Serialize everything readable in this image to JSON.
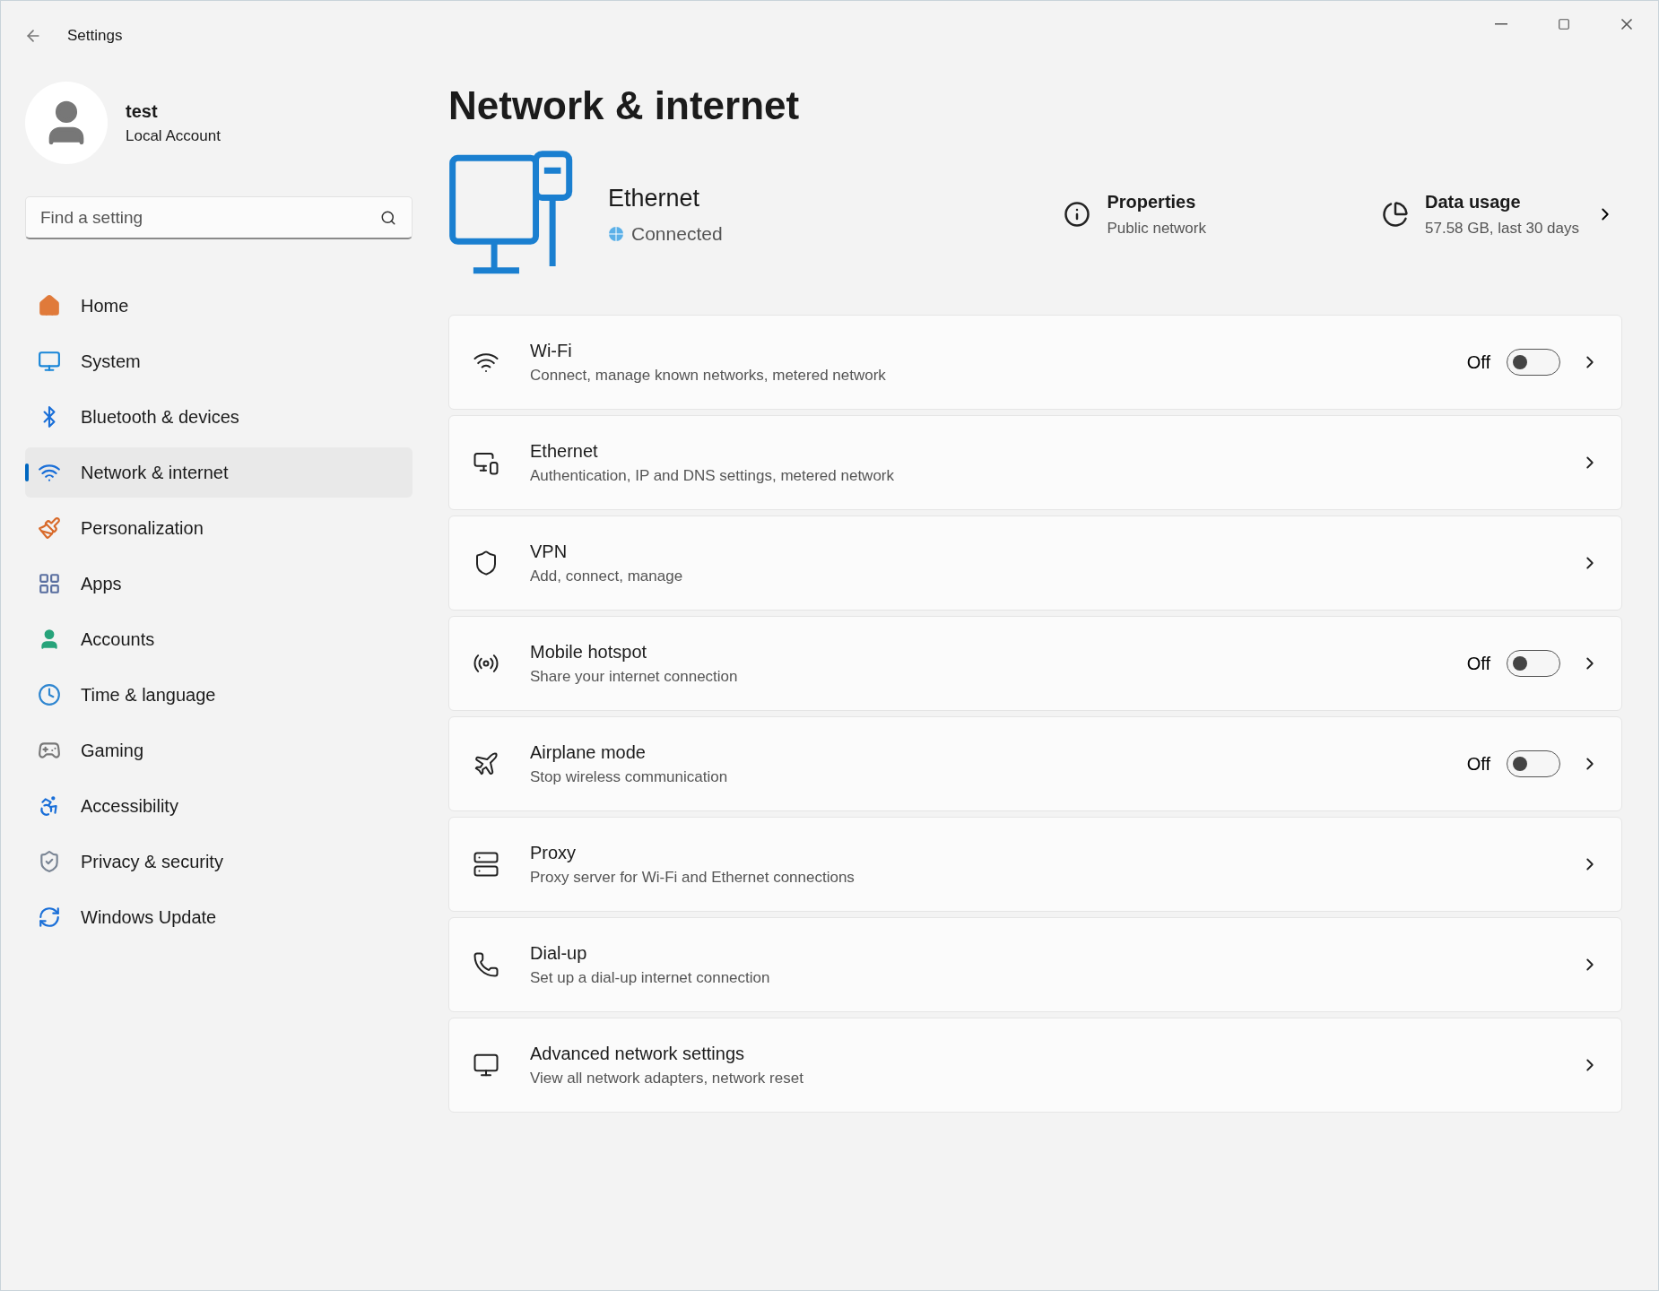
{
  "window": {
    "title": "Settings"
  },
  "user": {
    "name": "test",
    "account_type": "Local Account"
  },
  "search": {
    "placeholder": "Find a setting"
  },
  "sidebar": {
    "items": [
      {
        "label": "Home",
        "selected": false
      },
      {
        "label": "System",
        "selected": false
      },
      {
        "label": "Bluetooth & devices",
        "selected": false
      },
      {
        "label": "Network & internet",
        "selected": true
      },
      {
        "label": "Personalization",
        "selected": false
      },
      {
        "label": "Apps",
        "selected": false
      },
      {
        "label": "Accounts",
        "selected": false
      },
      {
        "label": "Time & language",
        "selected": false
      },
      {
        "label": "Gaming",
        "selected": false
      },
      {
        "label": "Accessibility",
        "selected": false
      },
      {
        "label": "Privacy & security",
        "selected": false
      },
      {
        "label": "Windows Update",
        "selected": false
      }
    ]
  },
  "page": {
    "title": "Network & internet",
    "connection": {
      "name": "Ethernet",
      "status": "Connected"
    },
    "properties": {
      "title": "Properties",
      "subtitle": "Public network"
    },
    "data_usage": {
      "title": "Data usage",
      "subtitle": "57.58 GB, last 30 days"
    },
    "cards": [
      {
        "kind": "toggle",
        "title": "Wi-Fi",
        "subtitle": "Connect, manage known networks, metered network",
        "state_label": "Off",
        "on": false
      },
      {
        "kind": "link",
        "title": "Ethernet",
        "subtitle": "Authentication, IP and DNS settings, metered network"
      },
      {
        "kind": "link",
        "title": "VPN",
        "subtitle": "Add, connect, manage"
      },
      {
        "kind": "toggle",
        "title": "Mobile hotspot",
        "subtitle": "Share your internet connection",
        "state_label": "Off",
        "on": false
      },
      {
        "kind": "toggle",
        "title": "Airplane mode",
        "subtitle": "Stop wireless communication",
        "state_label": "Off",
        "on": false
      },
      {
        "kind": "link",
        "title": "Proxy",
        "subtitle": "Proxy server for Wi-Fi and Ethernet connections"
      },
      {
        "kind": "link",
        "title": "Dial-up",
        "subtitle": "Set up a dial-up internet connection"
      },
      {
        "kind": "link",
        "title": "Advanced network settings",
        "subtitle": "View all network adapters, network reset"
      }
    ]
  }
}
